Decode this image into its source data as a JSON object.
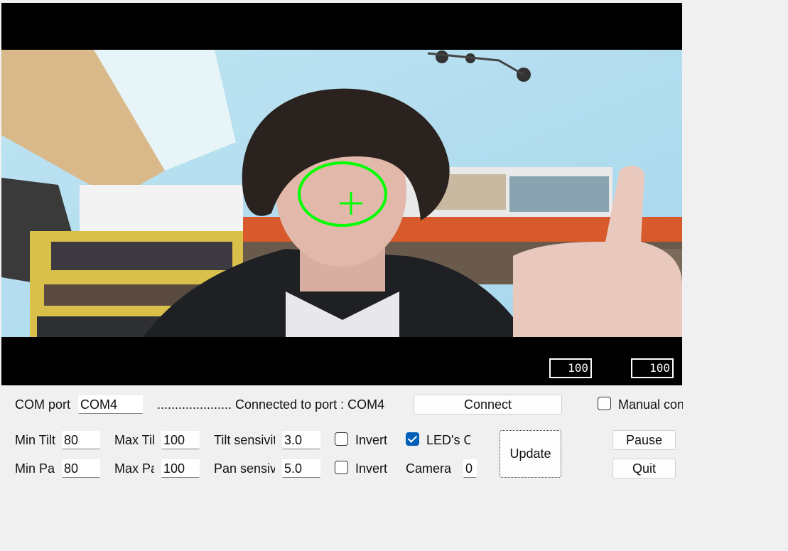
{
  "preview": {
    "overlay_color": "#00ff00",
    "lcd_left": "100",
    "lcd_right": "100"
  },
  "com": {
    "label": "COM port",
    "value": "COM4",
    "status": "..................... Connected to port : COM4",
    "connect_label": "Connect",
    "manual_label": "Manual control"
  },
  "tilt": {
    "min_label": "Min Tilt",
    "min_value": "80",
    "max_label": "Max Tilt",
    "max_value": "100",
    "sens_label": "Tilt sensivity",
    "sens_value": "3.0",
    "invert_label": "Invert"
  },
  "pan": {
    "min_label": "Min Pan",
    "min_value": "80",
    "max_label": "Max Pan",
    "max_value": "100",
    "sens_label": "Pan sensivity",
    "sens_value": "5.0",
    "invert_label": "Invert"
  },
  "leds": {
    "label": "LED's ON",
    "checked": true
  },
  "camera": {
    "label": "Camera",
    "value": "0"
  },
  "buttons": {
    "update": "Update",
    "pause": "Pause",
    "quit": "Quit"
  }
}
